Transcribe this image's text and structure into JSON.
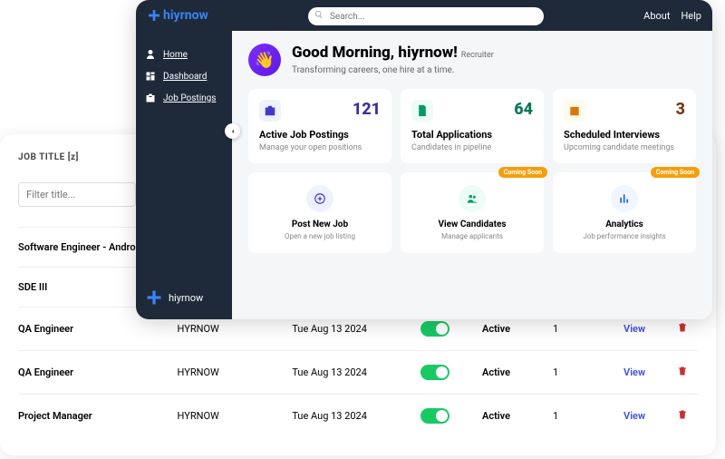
{
  "topbar": {
    "brand": "hiyrnow",
    "search_placeholder": "Search...",
    "nav": [
      "About",
      "Help"
    ]
  },
  "sidebar": {
    "items": [
      {
        "label": "Home"
      },
      {
        "label": "Dashboard"
      },
      {
        "label": "Job Postings"
      }
    ],
    "brand": "hiyrnow"
  },
  "greeting": {
    "title": "Good Morning, hiyrnow!",
    "role": "Recruiter",
    "tagline": "Transforming careers, one hire at a time."
  },
  "stats": [
    {
      "value": "121",
      "title": "Active Job Postings",
      "sub": "Manage your open positions"
    },
    {
      "value": "64",
      "title": "Total Applications",
      "sub": "Candidates in pipeline"
    },
    {
      "value": "3",
      "title": "Scheduled Interviews",
      "sub": "Upcoming candidate meetings"
    }
  ],
  "actions": [
    {
      "title": "Post New Job",
      "sub": "Open a new job listing",
      "badge": null
    },
    {
      "title": "View Candidates",
      "sub": "Manage applicants",
      "badge": "Coming Soon"
    },
    {
      "title": "Analytics",
      "sub": "Job performance insights",
      "badge": "Coming Soon"
    }
  ],
  "table": {
    "header": "JOB TITLE [z]",
    "filter_placeholder": "Filter title...",
    "rows": [
      {
        "title": "Software Engineer - Andro",
        "company": "",
        "date": "",
        "status": "",
        "apps": "",
        "view": ""
      },
      {
        "title": "SDE III",
        "company": "",
        "date": "",
        "status": "",
        "apps": "",
        "view": ""
      },
      {
        "title": "QA Engineer",
        "company": "HYRNOW",
        "date": "Tue Aug 13 2024",
        "status": "Active",
        "apps": "1",
        "view": "View"
      },
      {
        "title": "QA Engineer",
        "company": "HYRNOW",
        "date": "Tue Aug 13 2024",
        "status": "Active",
        "apps": "1",
        "view": "View"
      },
      {
        "title": "Project Manager",
        "company": "HYRNOW",
        "date": "Tue Aug 13 2024",
        "status": "Active",
        "apps": "1",
        "view": "View"
      }
    ]
  }
}
